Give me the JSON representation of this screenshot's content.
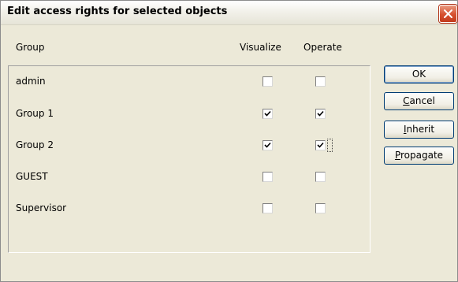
{
  "dialog": {
    "title": "Edit access rights for selected objects"
  },
  "columns": {
    "group": "Group",
    "visualize": "Visualize",
    "operate": "Operate"
  },
  "rows": [
    {
      "label": "admin",
      "visualize": false,
      "operate": false
    },
    {
      "label": "Group 1",
      "visualize": true,
      "operate": true
    },
    {
      "label": "Group 2",
      "visualize": true,
      "operate": true
    },
    {
      "label": "GUEST",
      "visualize": false,
      "operate": false
    },
    {
      "label": "Supervisor",
      "visualize": false,
      "operate": false
    }
  ],
  "buttons": {
    "ok": "OK",
    "cancel": {
      "mnemonic": "C",
      "rest": "ancel"
    },
    "inherit": {
      "mnemonic": "I",
      "rest": "nherit"
    },
    "propagate": {
      "mnemonic": "P",
      "rest": "ropagate"
    }
  },
  "icons": {
    "close": "close-icon",
    "check": "checkmark-icon"
  },
  "colors": {
    "face": "#ece9d8",
    "close_button": "#d6502f",
    "button_border": "#003c74"
  }
}
